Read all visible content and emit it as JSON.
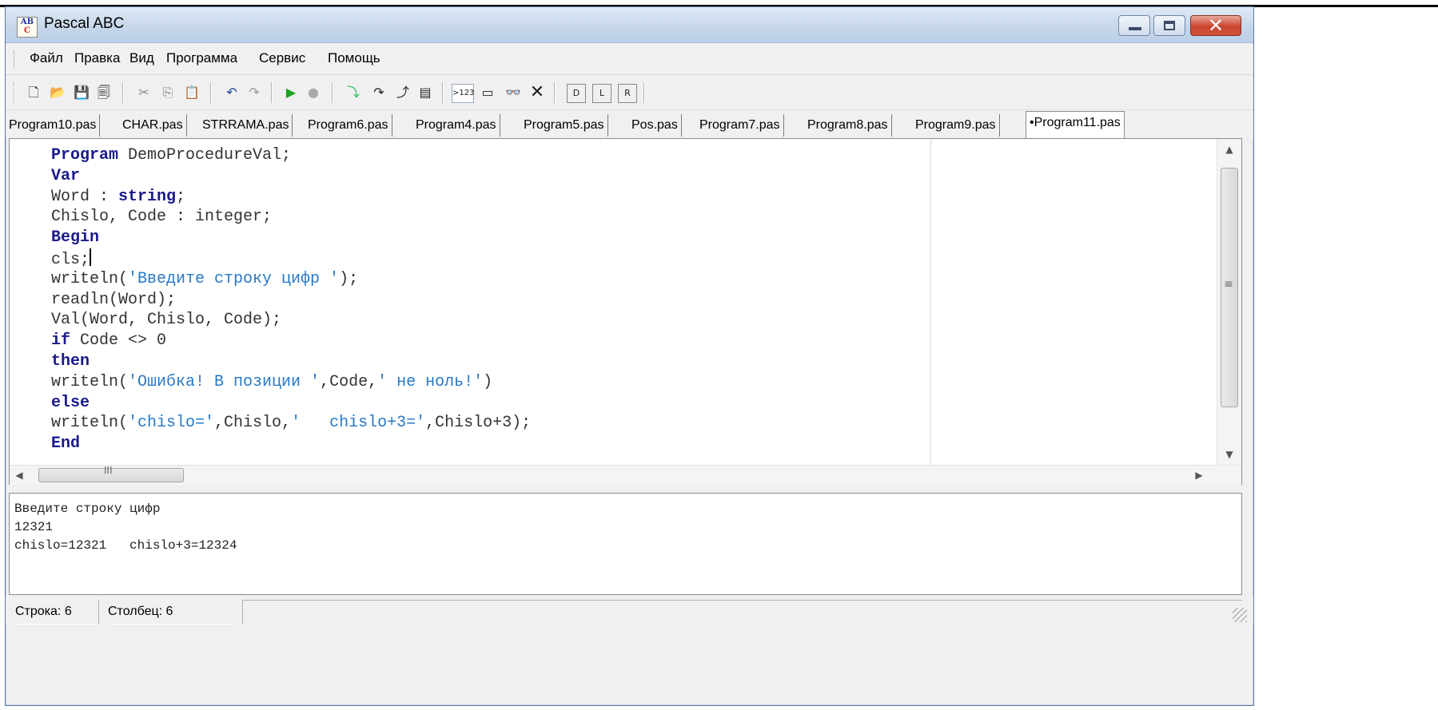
{
  "window": {
    "title": "Pascal ABC",
    "icon_text_top": "AB",
    "icon_text_bottom": "C"
  },
  "menu": {
    "items": [
      "Файл",
      "Правка",
      "Вид",
      "Программа",
      "Сервис",
      "Помощь"
    ]
  },
  "toolbar": {
    "icons": [
      "new-file-icon",
      "open-folder-icon",
      "save-icon",
      "save-all-icon",
      "cut-icon",
      "copy-icon",
      "paste-icon",
      "undo-icon",
      "redo-icon",
      "run-icon",
      "stop-icon",
      "step-into-icon",
      "step-over-icon",
      "step-out-icon",
      "watch-icon",
      "trace-icon",
      "window-icon",
      "glasses-icon",
      "close-icon",
      "format-d-icon",
      "format-l-icon",
      "format-r-icon"
    ]
  },
  "tabs": [
    {
      "label": "Program10.pas",
      "active": false
    },
    {
      "label": "CHAR.pas",
      "active": false
    },
    {
      "label": "STRRAMA.pas",
      "active": false
    },
    {
      "label": "Program6.pas",
      "active": false
    },
    {
      "label": "Program4.pas",
      "active": false
    },
    {
      "label": "Program5.pas",
      "active": false
    },
    {
      "label": "Pos.pas",
      "active": false
    },
    {
      "label": "Program7.pas",
      "active": false
    },
    {
      "label": "Program8.pas",
      "active": false
    },
    {
      "label": "Program9.pas",
      "active": false
    },
    {
      "label": "•Program11.pas",
      "active": true
    }
  ],
  "editor": {
    "lines": [
      [
        {
          "t": "Program",
          "c": "kw"
        },
        {
          "t": " DemoProcedureVal;",
          "c": ""
        }
      ],
      [
        {
          "t": "Var",
          "c": "kw"
        }
      ],
      [
        {
          "t": "Word : ",
          "c": ""
        },
        {
          "t": "string",
          "c": "kw"
        },
        {
          "t": ";",
          "c": ""
        }
      ],
      [
        {
          "t": "Chislo, Code : integer;",
          "c": ""
        }
      ],
      [
        {
          "t": "Begin",
          "c": "kw"
        }
      ],
      [
        {
          "t": "cls;",
          "c": ""
        },
        {
          "t": "",
          "c": "caret"
        }
      ],
      [
        {
          "t": "writeln(",
          "c": ""
        },
        {
          "t": "'Введите строку цифр '",
          "c": "str"
        },
        {
          "t": ");",
          "c": ""
        }
      ],
      [
        {
          "t": "readln(Word);",
          "c": ""
        }
      ],
      [
        {
          "t": "Val(Word, Chislo, Code);",
          "c": ""
        }
      ],
      [
        {
          "t": "if",
          "c": "kw"
        },
        {
          "t": " Code <> 0",
          "c": ""
        }
      ],
      [
        {
          "t": "then",
          "c": "kw"
        }
      ],
      [
        {
          "t": "writeln(",
          "c": ""
        },
        {
          "t": "'Ошибка! В позиции '",
          "c": "str"
        },
        {
          "t": ",Code,",
          "c": ""
        },
        {
          "t": "' не ноль!'",
          "c": "str"
        },
        {
          "t": ")",
          "c": ""
        }
      ],
      [
        {
          "t": "else",
          "c": "kw"
        }
      ],
      [
        {
          "t": "writeln(",
          "c": ""
        },
        {
          "t": "'chislo='",
          "c": "str"
        },
        {
          "t": ",Chislo,",
          "c": ""
        },
        {
          "t": "'   chislo+3='",
          "c": "str"
        },
        {
          "t": ",Chislo+3);",
          "c": ""
        }
      ],
      [
        {
          "t": "End",
          "c": "kw"
        }
      ]
    ]
  },
  "output": {
    "lines": [
      "Введите строку цифр",
      "12321",
      "chislo=12321   chislo+3=12324"
    ]
  },
  "status": {
    "row_label": "Строка: 6",
    "col_label": "Столбец: 6"
  }
}
